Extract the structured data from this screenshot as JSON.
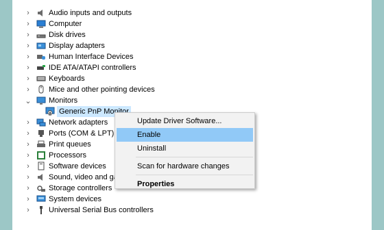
{
  "tree": {
    "items": [
      {
        "label": "Audio inputs and outputs",
        "icon": "speaker-icon",
        "expanded": false
      },
      {
        "label": "Computer",
        "icon": "computer-icon",
        "expanded": false
      },
      {
        "label": "Disk drives",
        "icon": "disk-drive-icon",
        "expanded": false
      },
      {
        "label": "Display adapters",
        "icon": "display-adapter-icon",
        "expanded": false
      },
      {
        "label": "Human Interface Devices",
        "icon": "hid-icon",
        "expanded": false
      },
      {
        "label": "IDE ATA/ATAPI controllers",
        "icon": "ide-controller-icon",
        "expanded": false
      },
      {
        "label": "Keyboards",
        "icon": "keyboard-icon",
        "expanded": false
      },
      {
        "label": "Mice and other pointing devices",
        "icon": "mouse-icon",
        "expanded": false
      },
      {
        "label": "Monitors",
        "icon": "monitor-icon",
        "expanded": true
      },
      {
        "label": "Network adapters",
        "icon": "network-adapter-icon",
        "expanded": false
      },
      {
        "label": "Ports (COM & LPT)",
        "icon": "port-icon",
        "expanded": false
      },
      {
        "label": "Print queues",
        "icon": "printer-icon",
        "expanded": false
      },
      {
        "label": "Processors",
        "icon": "processor-icon",
        "expanded": false
      },
      {
        "label": "Software devices",
        "icon": "software-device-icon",
        "expanded": false
      },
      {
        "label": "Sound, video and gar",
        "icon": "sound-icon",
        "expanded": false
      },
      {
        "label": "Storage controllers",
        "icon": "storage-controller-icon",
        "expanded": false
      },
      {
        "label": "System devices",
        "icon": "system-device-icon",
        "expanded": false
      },
      {
        "label": "Universal Serial Bus controllers",
        "icon": "usb-icon",
        "expanded": false
      }
    ],
    "monitor_child": {
      "label": "Generic PnP Monitor",
      "icon": "monitor-disabled-icon"
    }
  },
  "context_menu": {
    "update": "Update Driver Software...",
    "enable": "Enable",
    "uninstall": "Uninstall",
    "scan": "Scan for hardware changes",
    "properties": "Properties"
  },
  "colors": {
    "background": "#9cc7c6",
    "selection": "#cce8ff",
    "menu_hover": "#91c9f7"
  }
}
